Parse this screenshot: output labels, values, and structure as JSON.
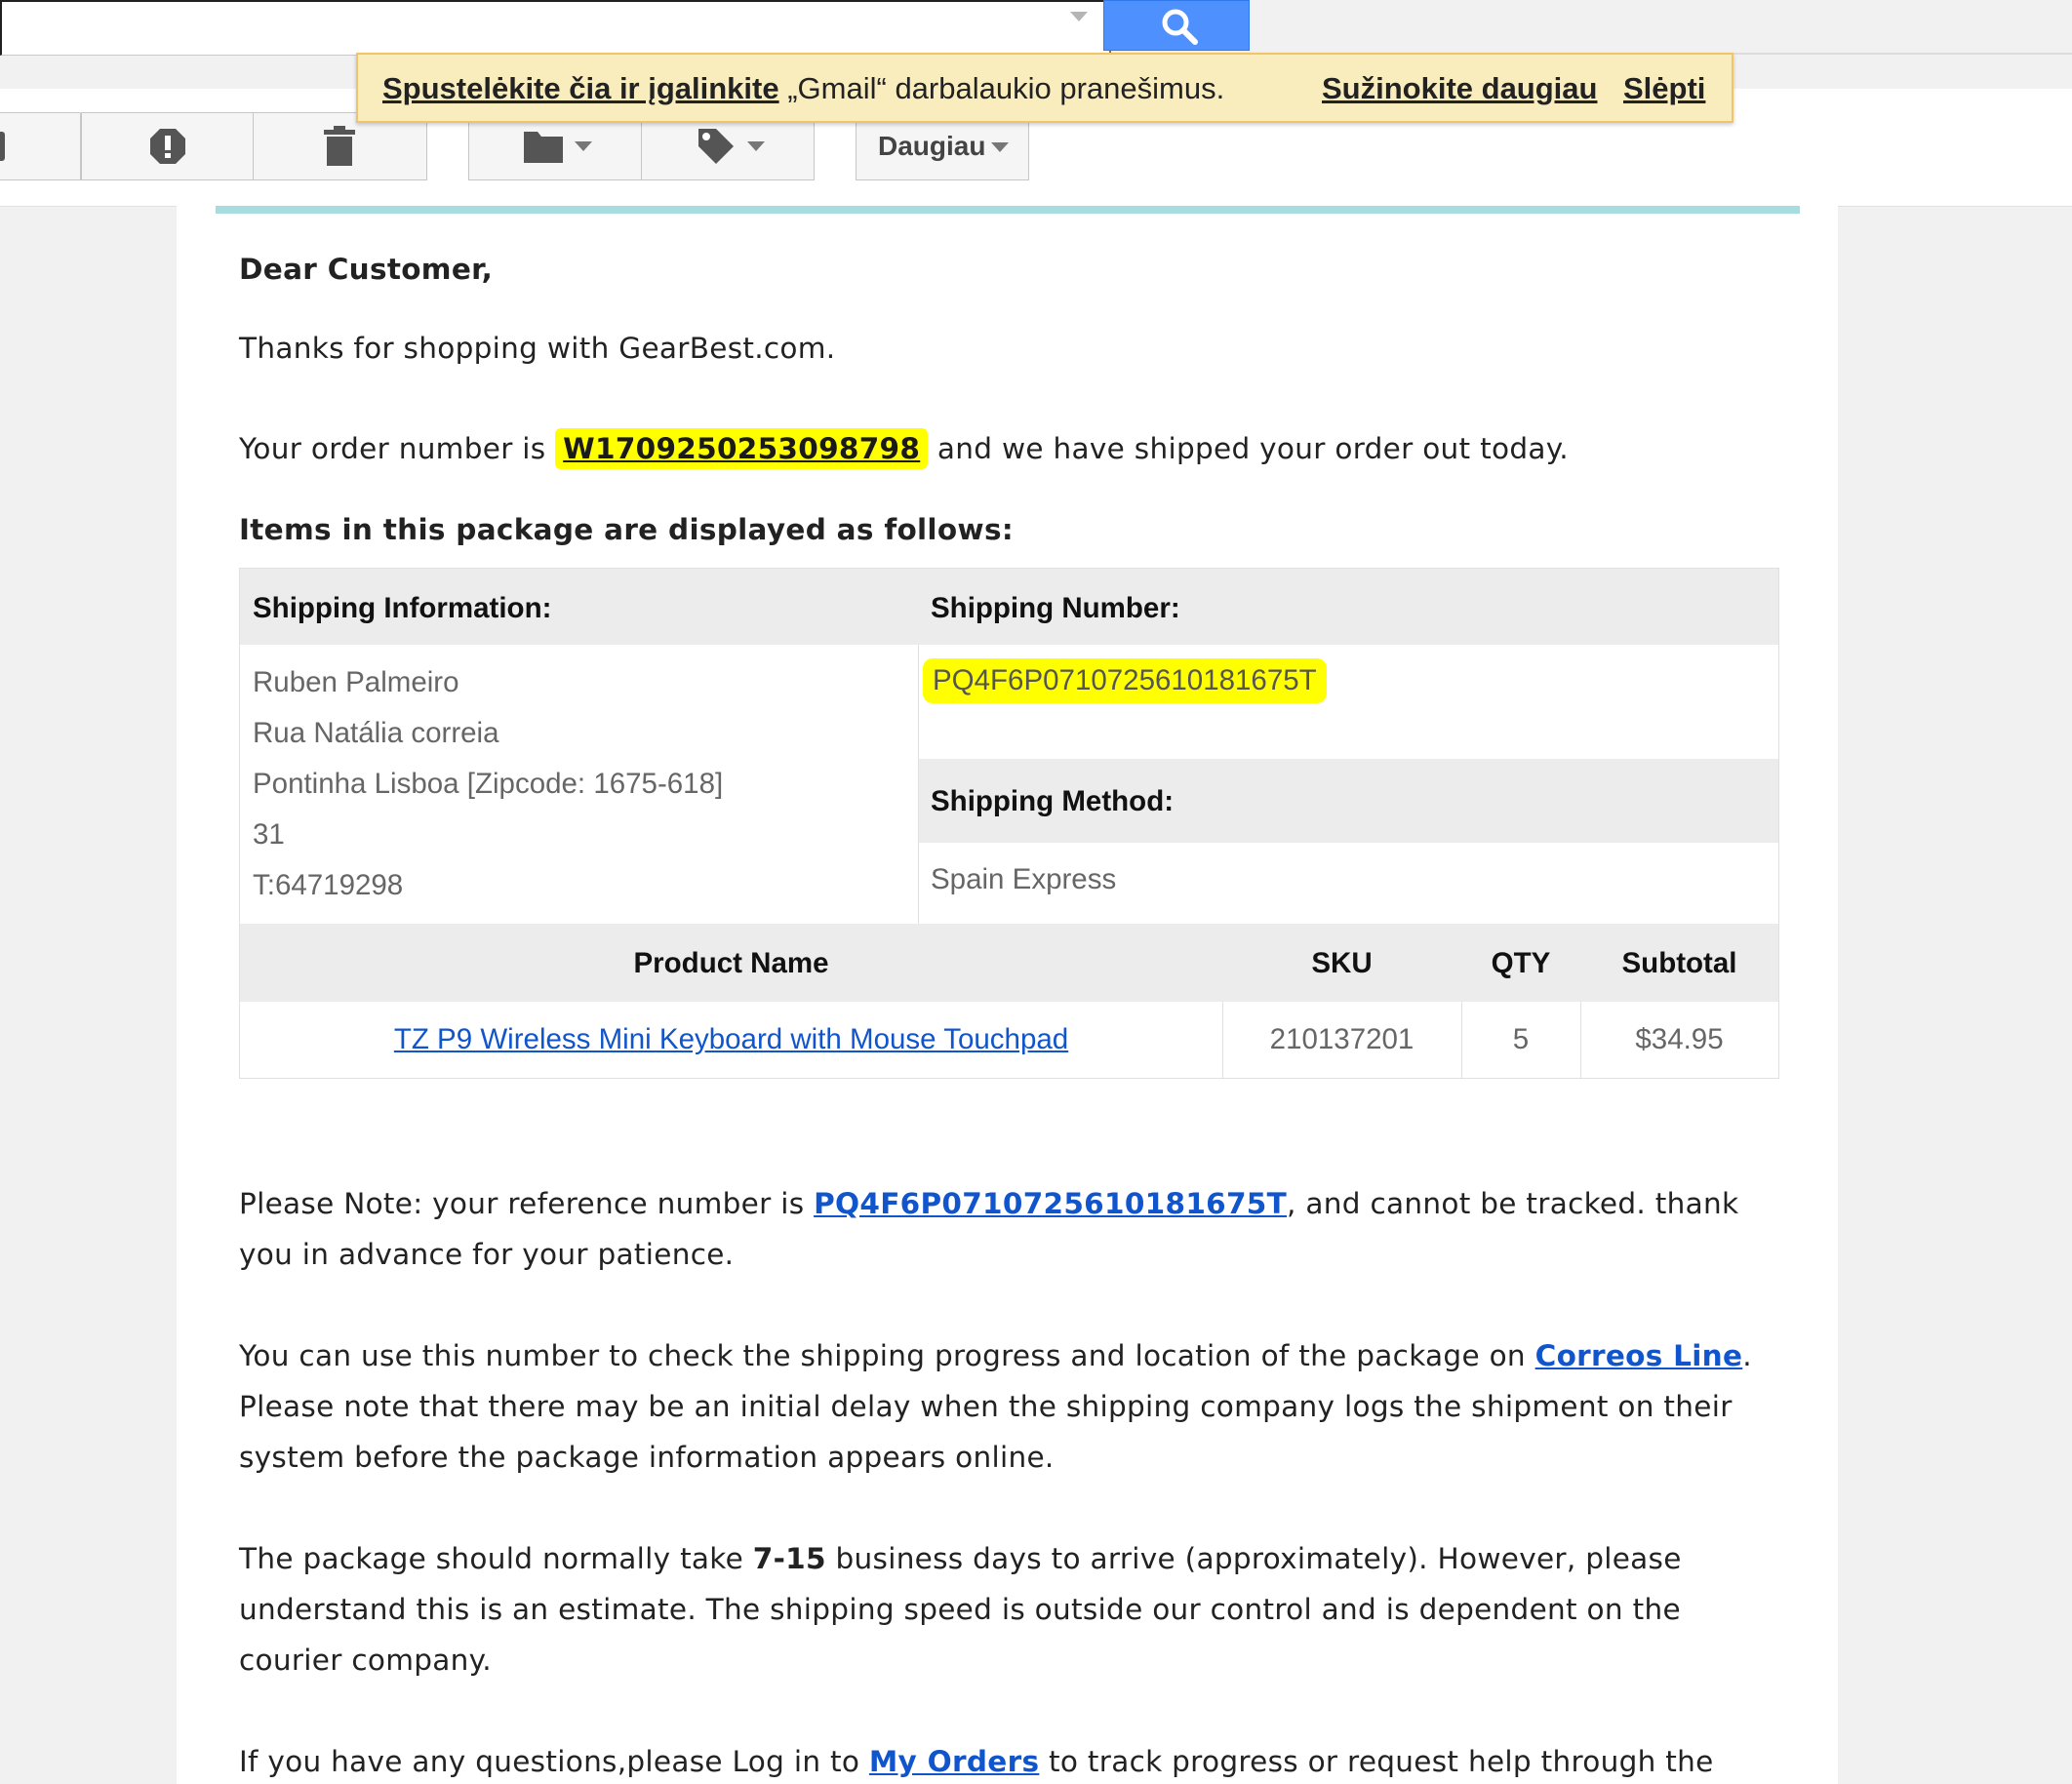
{
  "search": {
    "placeholder": ""
  },
  "toolbar": {
    "more_label": "Daugiau"
  },
  "notification": {
    "enable_link": "Spustelėkite čia ir įgalinkite",
    "message": "„Gmail“ darbalaukio pranešimus.",
    "learn_more": "Sužinokite daugiau",
    "hide": "Slėpti"
  },
  "email": {
    "greeting": "Dear Customer,",
    "thanks": "Thanks for shopping with GearBest.com.",
    "order_prefix": "Your order number is",
    "order_number": "W1709250253098798",
    "order_suffix": "and we have shipped your order out today.",
    "items_heading": "Items in this package are displayed as follows:",
    "table": {
      "shipping_info_header": "Shipping Information:",
      "shipping_number_header": "Shipping Number:",
      "address_lines": [
        "Ruben Palmeiro",
        "Rua Natália correia",
        "Pontinha Lisboa [Zipcode: 1675-618]",
        "31",
        "T:64719298"
      ],
      "shipping_number": "PQ4F6P0710725610181675T",
      "shipping_method_header": "Shipping Method:",
      "shipping_method": "Spain Express",
      "columns": [
        "Product Name",
        "SKU",
        "QTY",
        "Subtotal"
      ],
      "rows": [
        {
          "product": "TZ P9 Wireless Mini Keyboard with Mouse Touchpad",
          "sku": "210137201",
          "qty": "5",
          "subtotal": "$34.95"
        }
      ]
    },
    "note_prefix": "Please Note: your reference number is",
    "note_ref": "PQ4F6P0710725610181675T",
    "note_suffix": ", and cannot be tracked. thank",
    "note_line2": "you in advance for your patience.",
    "track_prefix": "You can use this number to check the shipping progress and location of the package on",
    "track_link": "Correos Line",
    "track_period": ".",
    "track_line2": "Please note that there may be an initial delay when the shipping company logs the shipment on their",
    "track_line3": "system before the package information appears online.",
    "days_prefix": "The package should normally take",
    "days_value": "7-15",
    "days_suffix": "business days to arrive (approximately). However, please",
    "days_line2": "understand this is an estimate. The shipping speed is outside our control and is dependent on the",
    "days_line3": "courier company.",
    "questions_prefix": "If you have any questions,please Log in to",
    "questions_link": "My Orders",
    "questions_suffix": "to track progress or request help through the"
  },
  "icons": [
    "search-icon",
    "archive-icon",
    "report-spam-icon",
    "delete-icon",
    "folder-icon",
    "label-icon",
    "dropdown-caret-icon"
  ],
  "colors": {
    "search_button": "#4d90fe",
    "notification_bg": "#f9edbe",
    "highlight": "#ffff00",
    "link": "#1155cc"
  }
}
